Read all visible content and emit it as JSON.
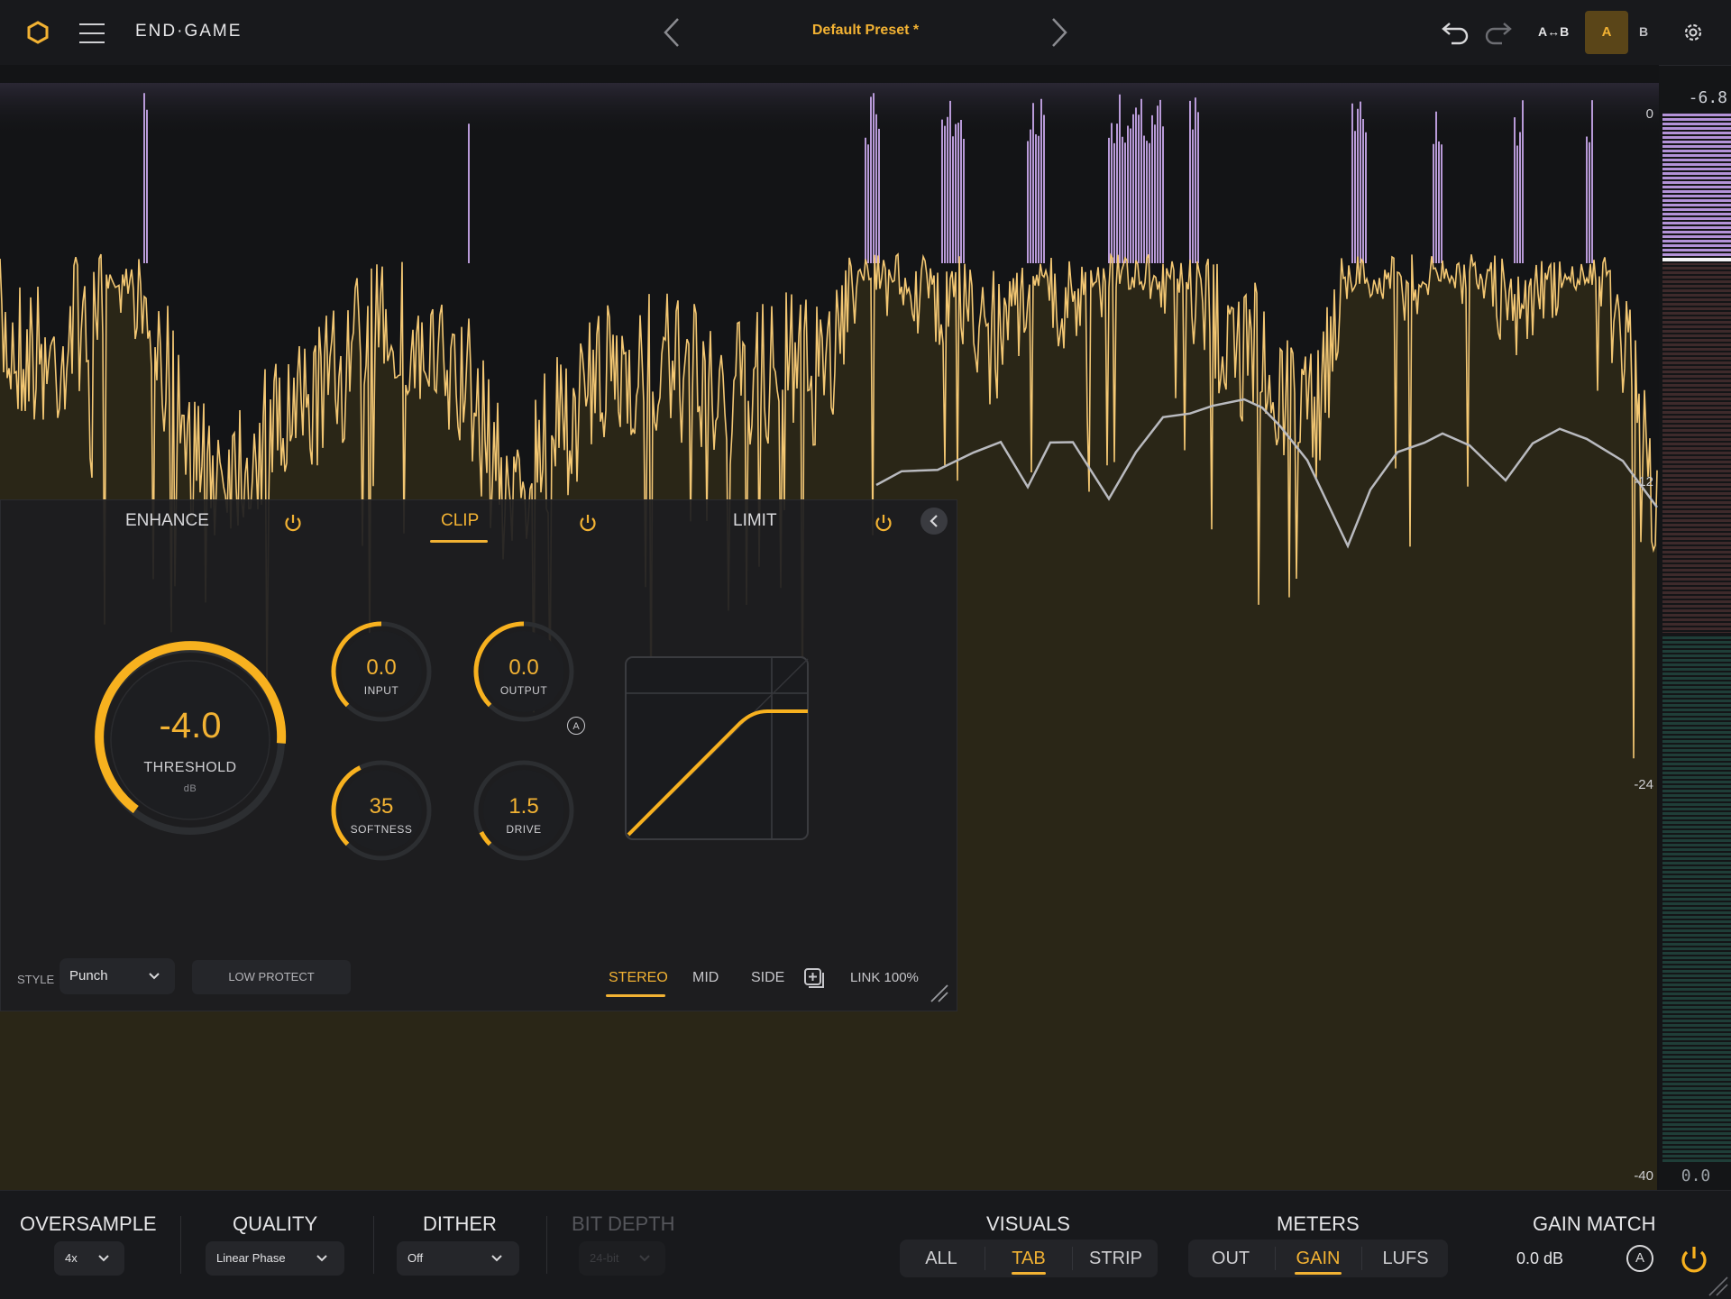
{
  "header": {
    "brand": "END·GAME",
    "preset_name": "Default Preset *",
    "ab_copy_label": "A↔B",
    "a_label": "A",
    "b_label": "B"
  },
  "display": {
    "db_labels": [
      "0",
      "-12",
      "-24",
      "-40"
    ],
    "meter_peak": "-6.8",
    "meter_bottom": "0.0"
  },
  "panel": {
    "tabs": [
      {
        "label": "ENHANCE",
        "active": false
      },
      {
        "label": "CLIP",
        "active": true
      },
      {
        "label": "LIMIT",
        "active": false
      }
    ],
    "threshold": {
      "value": "-4.0",
      "label": "THRESHOLD",
      "unit": "dB"
    },
    "knobs": {
      "input": {
        "value": "0.0",
        "label": "INPUT"
      },
      "output": {
        "value": "0.0",
        "label": "OUTPUT"
      },
      "softness": {
        "value": "35",
        "label": "SOFTNESS"
      },
      "drive": {
        "value": "1.5",
        "label": "DRIVE"
      }
    },
    "auto_badge": "A",
    "style_label": "STYLE",
    "style_value": "Punch",
    "low_protect": "LOW PROTECT",
    "modes": [
      "STEREO",
      "MID",
      "SIDE"
    ],
    "active_mode": "STEREO",
    "link": "LINK 100%"
  },
  "bottom": {
    "oversample": {
      "title": "OVERSAMPLE",
      "value": "4x"
    },
    "quality": {
      "title": "QUALITY",
      "value": "Linear Phase"
    },
    "dither": {
      "title": "DITHER",
      "value": "Off"
    },
    "bit_depth": {
      "title": "BIT DEPTH",
      "value": "24-bit"
    },
    "visuals": {
      "title": "VISUALS",
      "options": [
        "ALL",
        "TAB",
        "STRIP"
      ],
      "active": "TAB"
    },
    "meters": {
      "title": "METERS",
      "options": [
        "OUT",
        "GAIN",
        "LUFS"
      ],
      "active": "GAIN"
    },
    "gain_match": {
      "title": "GAIN MATCH",
      "value": "0.0 dB",
      "auto": "A"
    }
  },
  "colors": {
    "accent": "#f2b233",
    "clip_purple": "#b89ad8",
    "bg": "#141517"
  }
}
